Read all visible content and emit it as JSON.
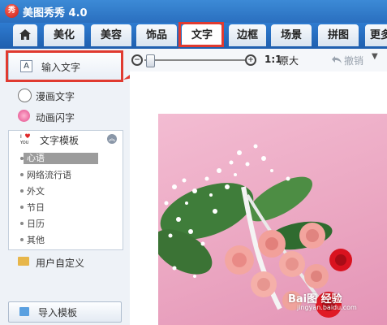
{
  "app": {
    "title": "美图秀秀 4.0",
    "logo_glyph": "秀"
  },
  "tabs": [
    "美化",
    "美容",
    "饰品",
    "文字",
    "边框",
    "场景",
    "拼图",
    "更多"
  ],
  "active_tab": "文字",
  "sidebar": {
    "input_text": "输入文字",
    "comic_text": "漫画文字",
    "animated_text": "动画闪字",
    "template_header": "文字模板",
    "template_items": [
      "心语",
      "网络流行语",
      "外文",
      "节日",
      "日历",
      "其他"
    ],
    "selected_template": "心语",
    "user_defined": "用户自定义",
    "import_template": "导入模板"
  },
  "toolbar": {
    "ratio_label": "1:1",
    "original_size": "原大",
    "undo": "撤销"
  },
  "watermark": {
    "main": "Bai图 经验",
    "sub": "jingyan.baidu.com"
  },
  "colors": {
    "accent_red": "#e03a30",
    "title_blue": "#2a6fbf"
  }
}
